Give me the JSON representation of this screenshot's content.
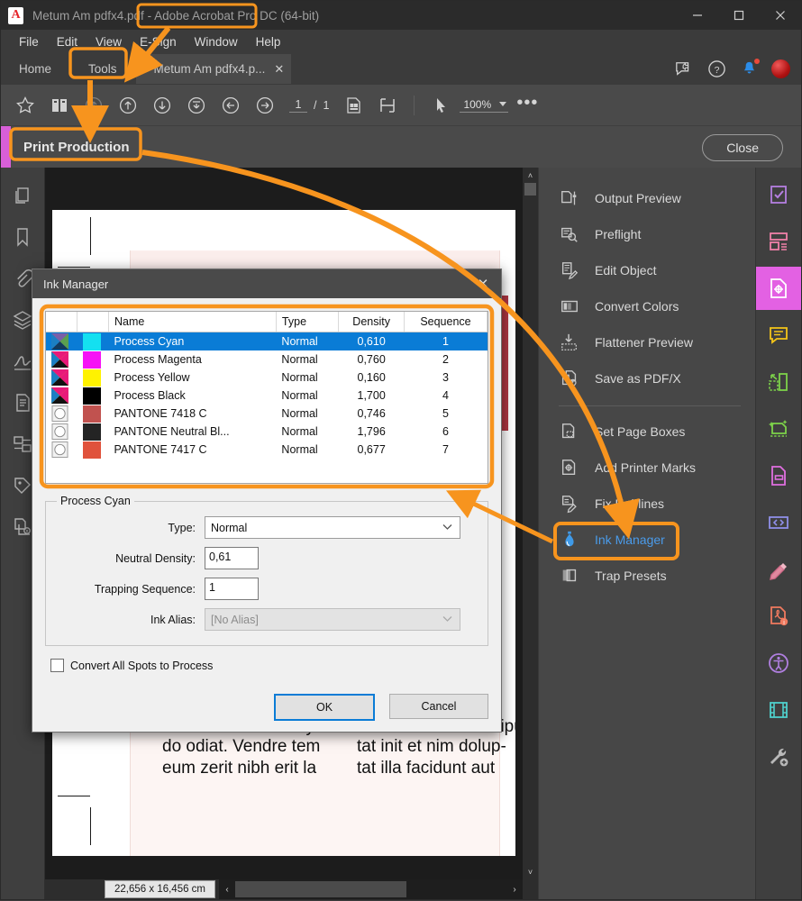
{
  "window": {
    "document_name": "Metum Am pdfx4.pdf",
    "app_name": "Adobe Acrobat Pro DC",
    "bitness": "(64-bit)",
    "minimize": "–",
    "maximize": "□",
    "close": "✕"
  },
  "menubar": [
    "File",
    "Edit",
    "View",
    "E-Sign",
    "Window",
    "Help"
  ],
  "tabs": {
    "home": "Home",
    "tools": "Tools",
    "document": "Metum Am pdfx4.p...",
    "document_close": "✕"
  },
  "toolbar": {
    "page_current": "1",
    "page_sep": "/",
    "page_total": "1",
    "zoom": "100%",
    "more": "•••"
  },
  "toolset": {
    "title": "Print Production",
    "close_label": "Close"
  },
  "tool_panel": {
    "group1": [
      {
        "label": "Output Preview",
        "icon": "output-preview-icon"
      },
      {
        "label": "Preflight",
        "icon": "preflight-icon"
      },
      {
        "label": "Edit Object",
        "icon": "edit-object-icon"
      },
      {
        "label": "Convert Colors",
        "icon": "convert-colors-icon"
      },
      {
        "label": "Flattener Preview",
        "icon": "flattener-preview-icon"
      },
      {
        "label": "Save as PDF/X",
        "icon": "save-as-pdfx-icon"
      }
    ],
    "group2": [
      {
        "label": "Set Page Boxes",
        "icon": "set-page-boxes-icon"
      },
      {
        "label": "Add Printer Marks",
        "icon": "add-printer-marks-icon"
      },
      {
        "label": "Fix Hairlines",
        "icon": "fix-hairlines-icon"
      },
      {
        "label": "Ink Manager",
        "icon": "ink-manager-icon",
        "active": true
      },
      {
        "label": "Trap Presets",
        "icon": "trap-presets-icon"
      }
    ]
  },
  "dialog": {
    "title": "Ink Manager",
    "close": "✕",
    "columns": [
      "",
      "",
      "Name",
      "Type",
      "Density",
      "Sequence"
    ],
    "rows": [
      {
        "name": "Process Cyan",
        "type": "Normal",
        "density": "0,610",
        "sequence": "1",
        "swatch": "#14e0f0",
        "kind": "process",
        "selected": true
      },
      {
        "name": "Process Magenta",
        "type": "Normal",
        "density": "0,760",
        "sequence": "2",
        "swatch": "#f612f6",
        "kind": "process",
        "selected": false
      },
      {
        "name": "Process Yellow",
        "type": "Normal",
        "density": "0,160",
        "sequence": "3",
        "swatch": "#fff200",
        "kind": "process",
        "selected": false
      },
      {
        "name": "Process Black",
        "type": "Normal",
        "density": "1,700",
        "sequence": "4",
        "swatch": "#000000",
        "kind": "process",
        "selected": false
      },
      {
        "name": "PANTONE 7418 C",
        "type": "Normal",
        "density": "0,746",
        "sequence": "5",
        "swatch": "#c1524f",
        "kind": "spot",
        "selected": false
      },
      {
        "name": "PANTONE Neutral Bl...",
        "type": "Normal",
        "density": "1,796",
        "sequence": "6",
        "swatch": "#242424",
        "kind": "spot",
        "selected": false
      },
      {
        "name": "PANTONE 7417 C",
        "type": "Normal",
        "density": "0,677",
        "sequence": "7",
        "swatch": "#e0523c",
        "kind": "spot",
        "selected": false
      }
    ],
    "group_label": "Process Cyan",
    "fields": {
      "type_label": "Type:",
      "type_value": "Normal",
      "density_label": "Neutral Density:",
      "density_value": "0,61",
      "trapping_label": "Trapping Sequence:",
      "trapping_value": "1",
      "alias_label": "Ink Alias:",
      "alias_value": "[No Alias]"
    },
    "checkbox_label": "Convert All Spots to Process",
    "ok": "OK",
    "cancel": "Cancel"
  },
  "page_text": {
    "col1": [
      "ns at ulla raccummy nos",
      "do odiat. Vendre tem",
      "eum zerit nibh erit la"
    ],
    "col2": [
      "nis nisis ercin vel dipu-",
      "tat init et nim dolup-",
      "tat illa facidunt aut"
    ]
  },
  "statusbar": {
    "dimensions": "22,656 x 16,456 cm",
    "left_arrow": "‹",
    "right_arrow": "›",
    "down_arrow": "˅",
    "up_arrow": "˄"
  },
  "colors": {
    "accent_orange": "#f7941e",
    "selection_blue": "#0a7cd6",
    "panel_bg": "#474747",
    "active_pink": "#e361e3"
  }
}
